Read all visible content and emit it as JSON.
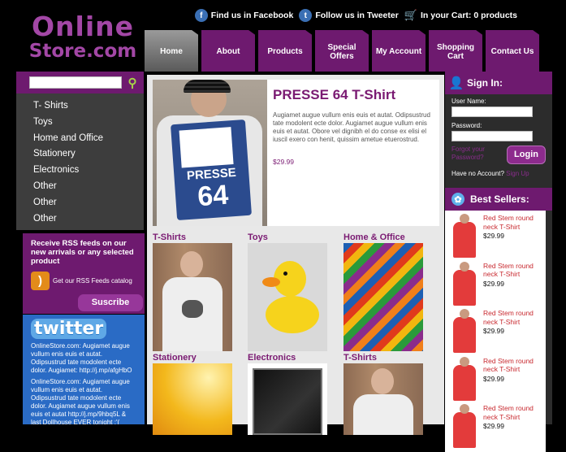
{
  "logo": {
    "line1": "Online",
    "line2": "Store.com"
  },
  "toplinks": {
    "facebook": "Find us in Facebook",
    "twitter": "Follow us in Tweeter",
    "cart": "In your Cart: 0 products"
  },
  "nav": [
    "Home",
    "About",
    "Products",
    "Special Offers",
    "My Account",
    "Shopping Cart",
    "Contact Us"
  ],
  "categories": [
    "T- Shirts",
    "Toys",
    "Home and Office",
    "Stationery",
    "Electronics",
    "Other",
    "Other",
    "Other"
  ],
  "rss": {
    "text": "Receive RSS feeds on our new arrivals or any selected product",
    "catalog": "Get our RSS Feeds catalog",
    "subscribe": "Suscribe"
  },
  "twitter": {
    "logo": "twitter",
    "tweet1": "OnlineStore.com: Augiamet augue vullum enis euis et autat. Odipsustrud tate modolent ecte dolor. Augiamet: http://j.mp/afgHbO",
    "tweet2": "OnlineStore.com: Augiamet augue vullum enis euis et autat. Odipsustrud tate modolent ecte dolor. Augiamet augue vullum enis euis et autat http://j.mp/9hbq5L & last Dollhouse EVER tonight :'("
  },
  "feature": {
    "title": "PRESSE 64 T-Shirt",
    "description": "Augiamet augue vullum enis euis et autat. Odipsustrud tate modolent ecte dolor. Augiamet augue vullum enis euis et autat. Obore vel dignibh el do conse ex elisi el iuscil exero con henit, quissim ametue etuerostrud.",
    "price": "$29.99",
    "bib_text": "PRESSE",
    "bib_number": "64"
  },
  "grid": [
    {
      "label": "T-Shirts"
    },
    {
      "label": "Toys"
    },
    {
      "label": "Home & Office"
    },
    {
      "label": "Stationery"
    },
    {
      "label": "Electronics"
    },
    {
      "label": "T-Shirts"
    }
  ],
  "signin": {
    "title": "Sign In:",
    "user_label": "User Name:",
    "pass_label": "Password:",
    "forgot": "Forgot your Password?",
    "login": "Login",
    "no_account": "Have no Account?",
    "signup": "Sign Up"
  },
  "bestsellers": {
    "title": "Best Sellers:",
    "items": [
      {
        "name": "Red Stem round neck T-Shirt",
        "price": "$29.99"
      },
      {
        "name": "Red Stem round neck T-Shirt",
        "price": "$29.99"
      },
      {
        "name": "Red Stem round neck T-Shirt",
        "price": "$29.99"
      },
      {
        "name": "Red Stem round neck T-Shirt",
        "price": "$29.99"
      },
      {
        "name": "Red Stem round neck T-Shirt",
        "price": "$29.99"
      }
    ]
  },
  "colors": {
    "brand_purple": "#6e1a6f",
    "logo_purple": "#a347a6",
    "price_red": "#c8292f",
    "twitter_blue": "#2a6bc5"
  }
}
